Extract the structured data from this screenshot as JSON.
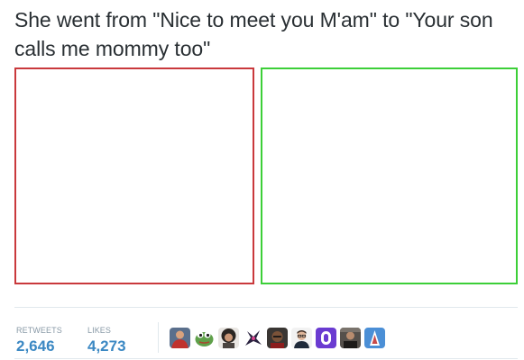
{
  "tweet": {
    "text": "She went from \"Nice to meet you M'am\" to \"Your son calls me mommy too\""
  },
  "stats": {
    "retweets_label": "RETWEETS",
    "retweets_value": "2,646",
    "likes_label": "LIKES",
    "likes_value": "4,273"
  },
  "liker_avatars": [
    {
      "icon": "avatar-person-red-jersey"
    },
    {
      "icon": "avatar-green-frog"
    },
    {
      "icon": "avatar-curly-hair-person"
    },
    {
      "icon": "avatar-dark-spiky-figure"
    },
    {
      "icon": "avatar-bald-man-dark"
    },
    {
      "icon": "avatar-man-glasses"
    },
    {
      "icon": "avatar-purple-badge"
    },
    {
      "icon": "avatar-person-dark-photo"
    },
    {
      "icon": "avatar-blue-figure"
    }
  ],
  "colors": {
    "left_frame_border": "#c9393c",
    "right_frame_border": "#3ccf38",
    "stat_value": "#3b88c3",
    "stat_label": "#8899a6"
  }
}
